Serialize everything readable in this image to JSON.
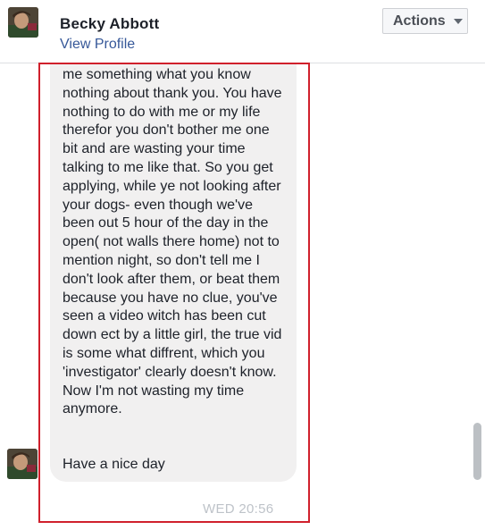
{
  "header": {
    "contact_name": "Becky Abbott",
    "view_profile_label": "View Profile",
    "actions_label": "Actions"
  },
  "conversation": {
    "message_text": "me something what you know\nnothing about thank you. You have\nnothing to do with me or my life\ntherefor you don't bother me one\nbit and are wasting your time\ntalking to me like that. So you get\napplying, while ye not looking after\nyour dogs- even though we've\nbeen out 5 hour of the day in the\nopen( not walls there home) not to\nmention night, so don't tell me I\ndon't look after them, or beat them\nbecause you have no clue, you've\nseen a video witch has been cut\ndown ect by a little girl, the true vid\nis some what diffrent, which you\n'investigator' clearly doesn't know.\nNow I'm not wasting my time\nanymore.",
    "message_text_2": "Have a nice day",
    "timestamp": "WED 20:56"
  },
  "colors": {
    "link": "#365899",
    "bubble": "#f1f0f0",
    "highlight_border": "#d0202c"
  },
  "icons": [
    "caret-down-icon"
  ]
}
